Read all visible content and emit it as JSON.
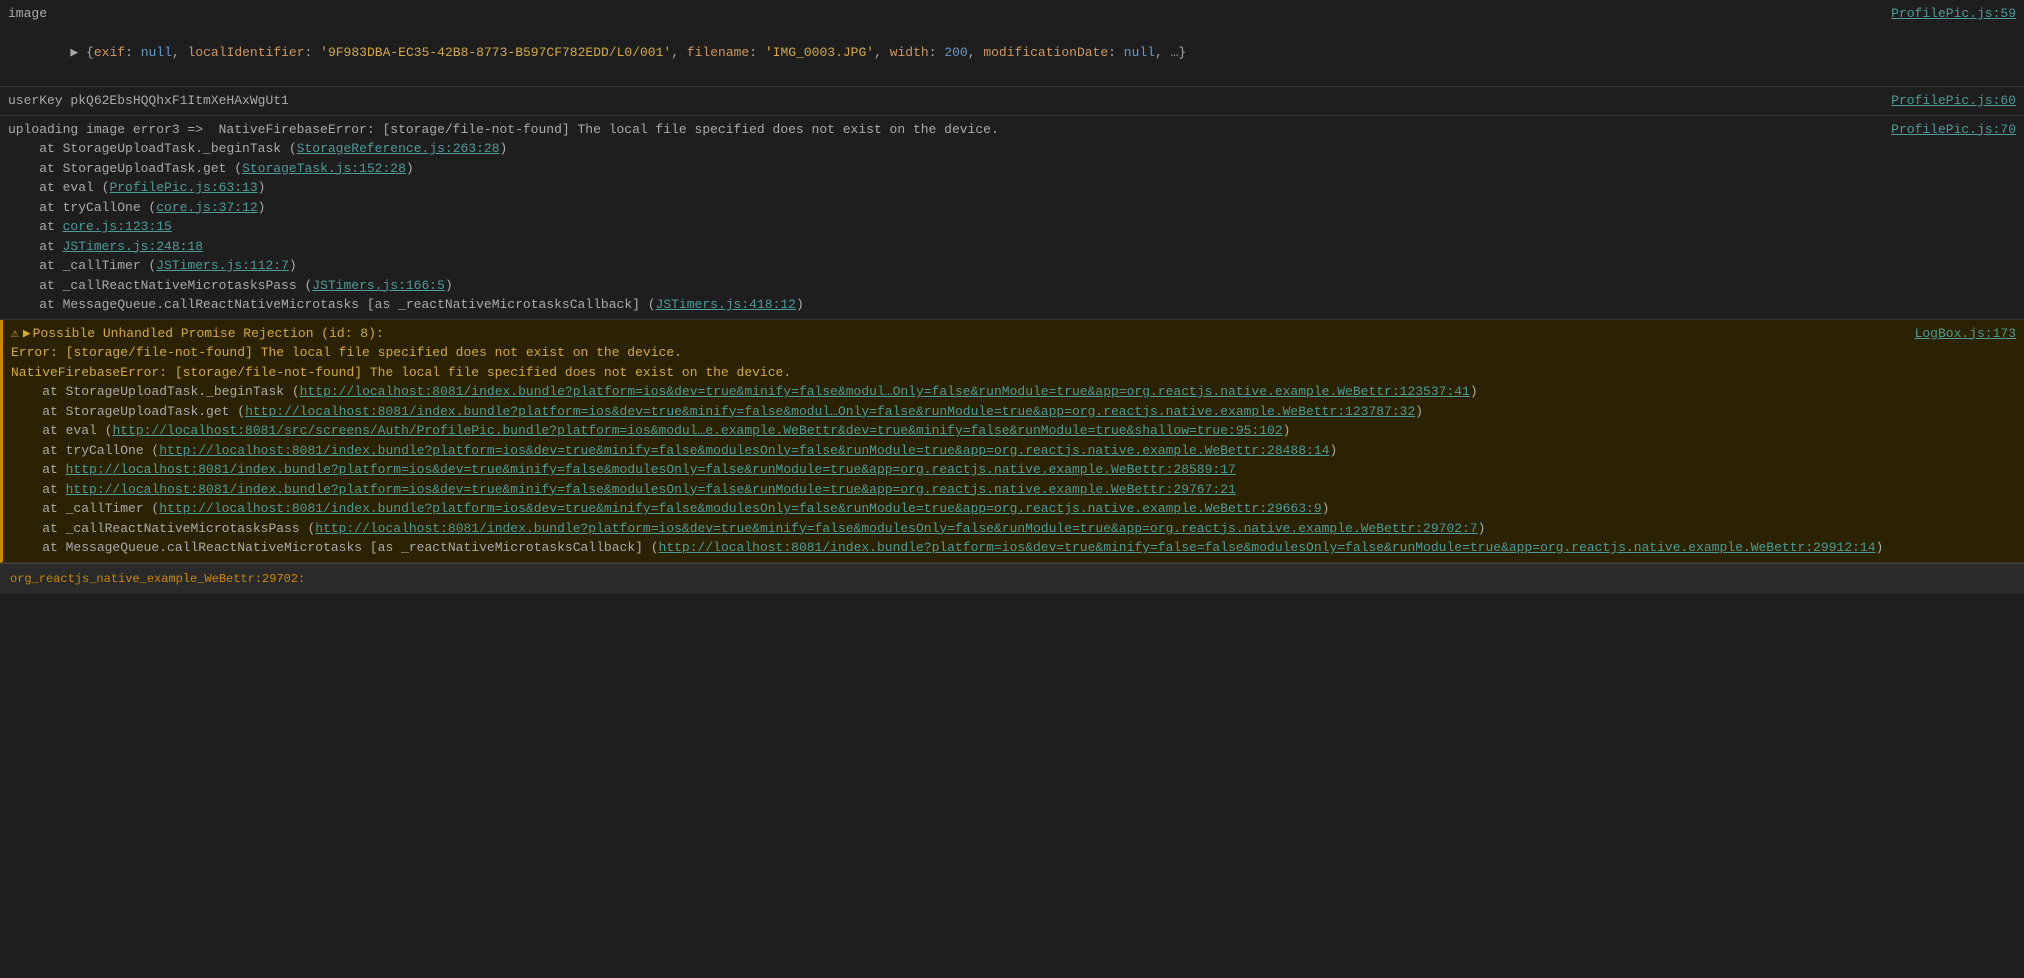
{
  "console": {
    "sections": [
      {
        "id": "image-section",
        "type": "dark",
        "lines": [
          {
            "id": "image-line",
            "text": "image",
            "source": "ProfilePic.js:59",
            "indent": 0
          },
          {
            "id": "image-exif",
            "text": "▶ {exif: null, localIdentifier: '9F983DBA-EC35-42B8-8773-B597CF782EDD/L0/001', filename: 'IMG_0003.JPG', width: 200, modificationDate: null, …}",
            "source": "",
            "indent": 0
          }
        ]
      },
      {
        "id": "userkey-section",
        "type": "dark",
        "lines": [
          {
            "id": "userkey-line",
            "text": "userKey pkQ62EbsHQQhxF1ItmXeHAxWgUt1",
            "source": "ProfilePic.js:60",
            "indent": 0
          }
        ]
      },
      {
        "id": "upload-error-section",
        "type": "dark",
        "lines": [
          {
            "id": "upload-error-main",
            "text": "uploading image error3 =>  NativeFirebaseError: [storage/file-not-found] The local file specified does not exist on the device.",
            "source": "ProfilePic.js:70",
            "indent": 0
          },
          {
            "id": "stack-1",
            "text": "    at StorageUploadTask._beginTask (StorageReference.js:263:28)",
            "source": "",
            "indent": 0,
            "link": "StorageReference.js:263:28"
          },
          {
            "id": "stack-2",
            "text": "    at StorageUploadTask.get (StorageTask.js:152:28)",
            "source": "",
            "indent": 0,
            "link": "StorageTask.js:152:28"
          },
          {
            "id": "stack-3",
            "text": "    at eval (ProfilePic.js:63:13)",
            "source": "",
            "indent": 0,
            "link": "ProfilePic.js:63:13"
          },
          {
            "id": "stack-4",
            "text": "    at tryCallOne (core.js:37:12)",
            "source": "",
            "indent": 0,
            "link": "core.js:37:12"
          },
          {
            "id": "stack-5",
            "text": "    at core.js:123:15",
            "source": "",
            "indent": 0,
            "link": "core.js:123:15"
          },
          {
            "id": "stack-6",
            "text": "    at JSTimers.js:248:18",
            "source": "",
            "indent": 0,
            "link": "JSTimers.js:248:18"
          },
          {
            "id": "stack-7",
            "text": "    at _callTimer (JSTimers.js:112:7)",
            "source": "",
            "indent": 0,
            "link": "JSTimers.js:112:7"
          },
          {
            "id": "stack-8",
            "text": "    at _callReactNativeMicrotasksPass (JSTimers.js:166:5)",
            "source": "",
            "indent": 0,
            "link": "JSTimers.js:166:5"
          },
          {
            "id": "stack-9",
            "text": "    at MessageQueue.callReactNativeMicrotasks [as _reactNativeMicrotasksCallback] (JSTimers.js:418:12)",
            "source": "",
            "indent": 0,
            "link": "JSTimers.js:418:12"
          }
        ]
      },
      {
        "id": "promise-warning-section",
        "type": "warning",
        "warning_header": "⚠ ▶ Possible Unhandled Promise Rejection (id: 8):",
        "source": "LogBox.js:173",
        "lines": [
          {
            "id": "promise-error-1",
            "text": "Error: [storage/file-not-found] The local file specified does not exist on the device."
          },
          {
            "id": "promise-error-2",
            "text": "NativeFirebaseError: [storage/file-not-found] The local file specified does not exist on the device."
          },
          {
            "id": "promise-stack-1",
            "prefix": "    at StorageUploadTask._beginTask (",
            "link_text": "http://localhost:8081/index.bundle?platform=ios&dev=true&minify=false&modul…Only=false&runModule=true&app=org.reactjs.native.example.WeBettr:123537:41",
            "suffix": ")"
          },
          {
            "id": "promise-stack-2",
            "prefix": "    at StorageUploadTask.get (",
            "link_text": "http://localhost:8081/index.bundle?platform=ios&dev=true&minify=false&modul…Only=false&runModule=true&app=org.reactjs.native.example.WeBettr:123787:32",
            "suffix": ")"
          },
          {
            "id": "promise-stack-3",
            "prefix": "    at eval (",
            "link_text": "http://localhost:8081/src/screens/Auth/ProfilePic.bundle?platform=ios&modul…e.example.WeBettr&dev=true&minify=false&runModule=true&shallow=true:95:102",
            "suffix": ")"
          },
          {
            "id": "promise-stack-4",
            "prefix": "    at tryCallOne (",
            "link_text": "http://localhost:8081/index.bundle?platform=ios&dev=true&minify=false&modulesOnly=false&runModule=true&app=org.reactjs.native.example.WeBettr:28488:14",
            "suffix": ")"
          },
          {
            "id": "promise-stack-5",
            "prefix": "    at ",
            "link_text": "http://localhost:8081/index.bundle?platform=ios&dev=true&minify=false&modulesOnly=false&runModule=true&app=org.reactjs.native.example.WeBettr:28589:17",
            "suffix": ""
          },
          {
            "id": "promise-stack-6",
            "prefix": "    at ",
            "link_text": "http://localhost:8081/index.bundle?platform=ios&dev=true&minify=false&modulesOnly=false&runModule=true&app=org.reactjs.native.example.WeBettr:29767:21",
            "suffix": ""
          },
          {
            "id": "promise-stack-7",
            "prefix": "    at _callTimer (",
            "link_text": "http://localhost:8081/index.bundle?platform=ios&dev=true&minify=false&modulesOnly=false&runModule=true&app=org.reactjs.native.example.WeBettr:29663:9",
            "suffix": ")"
          },
          {
            "id": "promise-stack-8",
            "prefix": "    at _callReactNativeMicrotasksPass (",
            "link_text": "http://localhost:8081/index.bundle?platform=ios&dev=true&minify=false&modulesOnly=false&runModule=true&app=org.reactjs.native.example.WeBettr:29702:7",
            "suffix": ")"
          },
          {
            "id": "promise-stack-9",
            "prefix": "    at MessageQueue.callReactNativeMicrotasks [as _reactNativeMicrotasksCallback] (",
            "link_text": "http://localhost:8081/index.bundle?platform=ios&dev=true&minify=false=false&modulesOnly=false&runModule=true&app=org.reactjs.native.example.WeBettr:29912:14",
            "suffix": ")"
          }
        ]
      }
    ],
    "bottom_bar": {
      "label": "org_reactjs_native_example_WeBettr:29702:",
      "label2": ""
    }
  }
}
